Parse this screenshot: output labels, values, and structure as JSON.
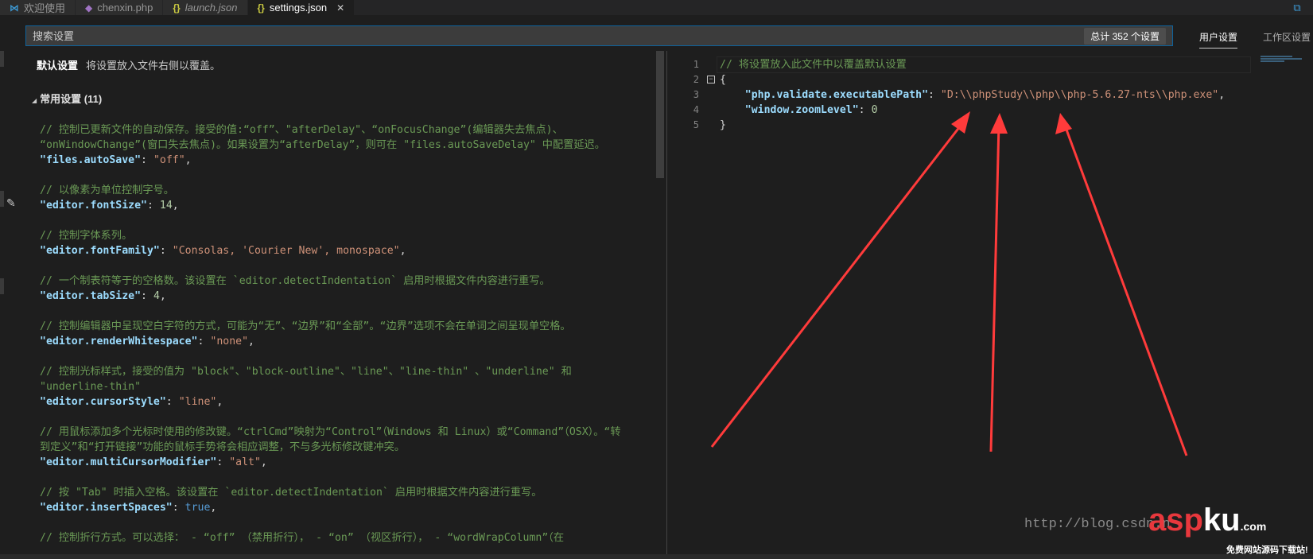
{
  "tabs": [
    {
      "label": "欢迎使用",
      "icon": "vscode-icon"
    },
    {
      "label": "chenxin.php",
      "icon": "php-icon"
    },
    {
      "label": "launch.json",
      "icon": "json-icon"
    },
    {
      "label": "settings.json",
      "icon": "json-icon",
      "active": true
    }
  ],
  "search": {
    "placeholder": "搜索设置",
    "count": "总计 352 个设置"
  },
  "scopes": {
    "user": "用户设置",
    "workspace": "工作区设置"
  },
  "left": {
    "header_title": "默认设置",
    "header_desc": "将设置放入文件右侧以覆盖。",
    "group": "常用设置 (11)"
  },
  "right": {
    "line_numbers": [
      "1",
      "2",
      "3",
      "4",
      "5"
    ]
  },
  "watermark": {
    "url": "http://blog.csdn.n",
    "logo_a": "asp",
    "logo_b": "ku",
    "logo_suffix": ".com",
    "sub": "免费网站源码下载站!"
  },
  "colors": {
    "accent": "#0e639c",
    "arrow": "#ff3b3b"
  }
}
